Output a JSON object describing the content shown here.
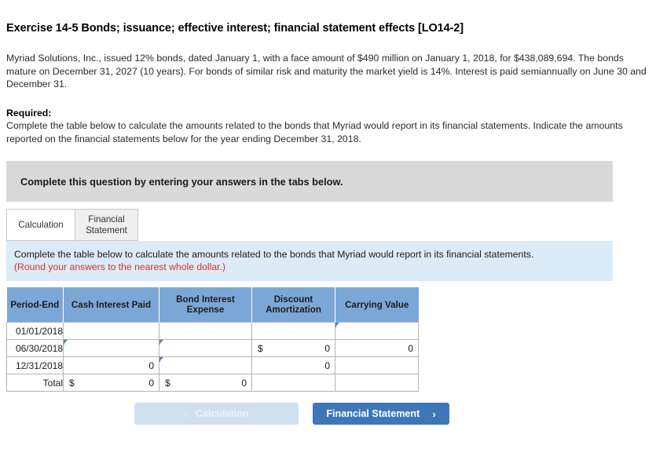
{
  "exercise": {
    "title": "Exercise 14-5 Bonds; issuance; effective interest; financial statement effects [LO14-2]",
    "problem_text": "Myriad Solutions, Inc., issued 12% bonds, dated January 1, with a face amount of $490 million on January 1, 2018, for $438,089,694. The bonds mature on December 31, 2027 (10 years). For bonds of similar risk and maturity the market yield is 14%. Interest is paid semiannually on June 30 and December 31.",
    "required_label": "Required:",
    "required_text": "Complete the table below to calculate the amounts related to the bonds that Myriad would report in its financial statements. Indicate the amounts reported on the financial statements below for the year ending December 31, 2018."
  },
  "banner": {
    "text": "Complete this question by entering your answers in the tabs below."
  },
  "tabs": [
    {
      "label": "Calculation",
      "active": true
    },
    {
      "label": "Financial Statement",
      "label_line1": "Financial",
      "label_line2": "Statement",
      "active": false
    }
  ],
  "instruction": {
    "line1": "Complete the table below to calculate the amounts related to the bonds that Myriad would report in its financial statements.",
    "line2": "(Round your answers to the nearest whole dollar.)",
    "line2_color": "#d0342c",
    "background": "#dcebf8"
  },
  "table": {
    "header_background": "#7ba7d7",
    "columns": [
      "Period-End",
      "Cash Interest Paid",
      "Bond Interest Expense",
      "Discount Amortization",
      "Carrying Value"
    ],
    "column_header_lines": {
      "bond_interest_expense_line1": "Bond Interest",
      "bond_interest_expense_line2": "Expense",
      "discount_amortization_line1": "Discount",
      "discount_amortization_line2": "Amortization"
    },
    "rows": [
      {
        "period": "01/01/2018",
        "cash_interest_paid": {
          "symbol": "",
          "value": ""
        },
        "bond_interest_expense": {
          "symbol": "",
          "value": ""
        },
        "discount_amortization": {
          "symbol": "",
          "value": ""
        },
        "carrying_value": {
          "symbol": "",
          "value": ""
        }
      },
      {
        "period": "06/30/2018",
        "cash_interest_paid": {
          "symbol": "",
          "value": ""
        },
        "bond_interest_expense": {
          "symbol": "",
          "value": ""
        },
        "discount_amortization": {
          "symbol": "$",
          "value": "0"
        },
        "carrying_value": {
          "symbol": "",
          "value": "0"
        }
      },
      {
        "period": "12/31/2018",
        "cash_interest_paid": {
          "symbol": "",
          "value": "0"
        },
        "bond_interest_expense": {
          "symbol": "",
          "value": ""
        },
        "discount_amortization": {
          "symbol": "",
          "value": "0"
        },
        "carrying_value": {
          "symbol": "",
          "value": ""
        }
      },
      {
        "period": "Total",
        "cash_interest_paid": {
          "symbol": "$",
          "value": "0"
        },
        "bond_interest_expense": {
          "symbol": "$",
          "value": "0"
        },
        "discount_amortization": {
          "symbol": "",
          "value": ""
        },
        "carrying_value": {
          "symbol": "",
          "value": ""
        }
      }
    ]
  },
  "navigation": {
    "prev_label": "Calculation",
    "prev_chevron": "‹",
    "next_label": "Financial Statement",
    "next_chevron": "›",
    "next_background": "#3d77b8",
    "prev_background": "#cfe0f1"
  }
}
